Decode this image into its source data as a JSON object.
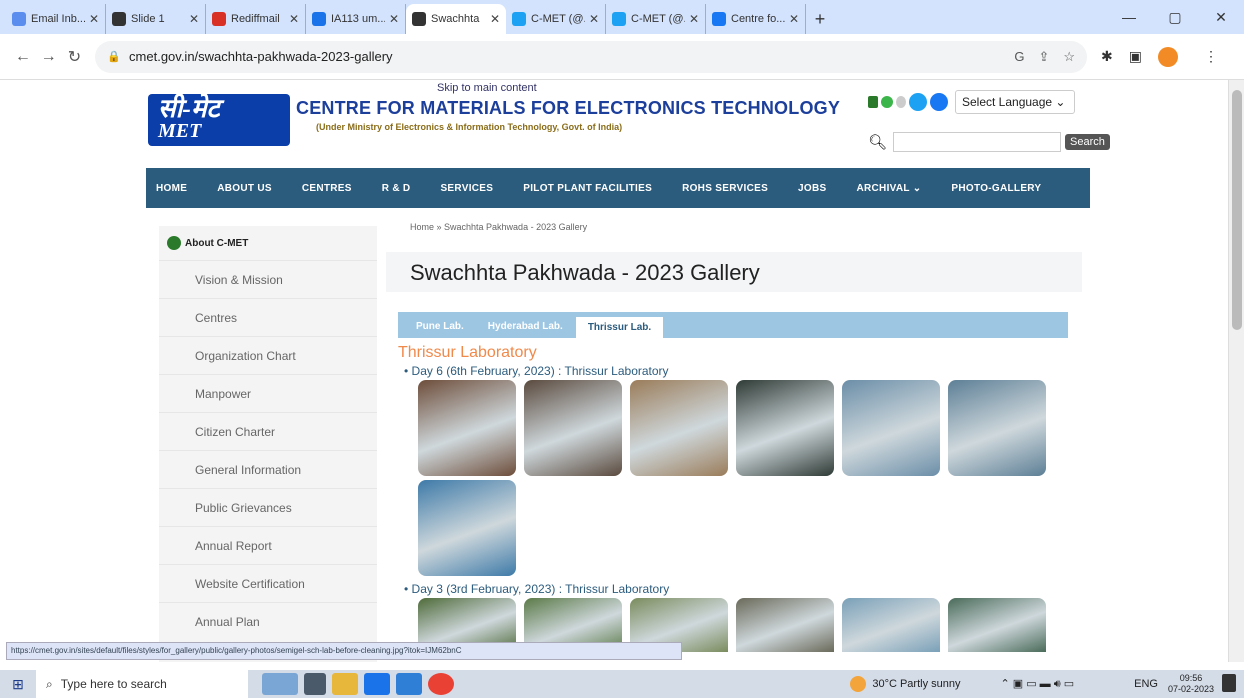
{
  "browser": {
    "tabs": [
      {
        "label": "Email Inb...",
        "color": "#5b8def"
      },
      {
        "label": "Slide 1",
        "color": "#333333"
      },
      {
        "label": "Rediffmail",
        "color": "#d93025"
      },
      {
        "label": "IA113 um...",
        "color": "#1a73e8"
      },
      {
        "label": "Swachhta",
        "color": "#333333",
        "active": true
      },
      {
        "label": "C-MET (@...",
        "color": "#1da1f2"
      },
      {
        "label": "C-MET (@...",
        "color": "#1da1f2"
      },
      {
        "label": "Centre fo...",
        "color": "#1877f2"
      }
    ],
    "url": "cmet.gov.in/swachhta-pakhwada-2023-gallery"
  },
  "site": {
    "skip_link": "Skip to main content",
    "org_name": "CENTRE FOR MATERIALS FOR ELECTRONICS TECHNOLOGY",
    "org_sub": "(Under Ministry of Electronics & Information Technology, Govt. of India)",
    "logo_top": "सी-मेट",
    "logo_bottom": "MET",
    "language": "Select Language ⌄",
    "search_btn": "Search",
    "nav": [
      "HOME",
      "ABOUT US",
      "CENTRES",
      "R & D",
      "SERVICES",
      "PILOT PLANT FACILITIES",
      "ROHS SERVICES",
      "JOBS",
      "ARCHIVAL ⌄",
      "PHOTO-GALLERY"
    ]
  },
  "sidebar": {
    "heading": "About C-MET",
    "items": [
      "Vision & Mission",
      "Centres",
      "Organization Chart",
      "Manpower",
      "Citizen Charter",
      "General Information",
      "Public Grievances",
      "Annual Report",
      "Website Certification",
      "Annual Plan"
    ]
  },
  "content": {
    "breadcrumb": "Home » Swachhta Pakhwada - 2023 Gallery",
    "title": "Swachhta Pakhwada - 2023 Gallery",
    "tabs": [
      "Pune Lab.",
      "Hyderabad Lab.",
      "Thrissur Lab."
    ],
    "active_tab": "Thrissur Lab.",
    "lab_heading": "Thrissur Laboratory",
    "day6": "• Day 6 (6th February, 2023) : Thrissur Laboratory",
    "day3": "• Day 3 (3rd February, 2023) : Thrissur Laboratory",
    "day6_thumbs": [
      "#6d4d3a",
      "#5a4a3e",
      "#9a7c5a",
      "#2f3b36",
      "#6b8ea8",
      "#5d7f96",
      "#3e7aa8"
    ],
    "day3_thumbs": [
      "#4f6b3a",
      "#5b7a48",
      "#7a8c5e",
      "#6a6a5a",
      "#7aa0b8",
      "#4a6b5a"
    ]
  },
  "status_url": "https://cmet.gov.in/sites/default/files/styles/for_gallery/public/gallery-photos/semigel-sch-lab-before-cleaning.jpg?itok=IJM62bnC",
  "taskbar": {
    "search_placeholder": "Type here to search",
    "weather": "30°C  Partly sunny",
    "lang": "ENG",
    "time": "09:56",
    "date": "07-02-2023"
  }
}
